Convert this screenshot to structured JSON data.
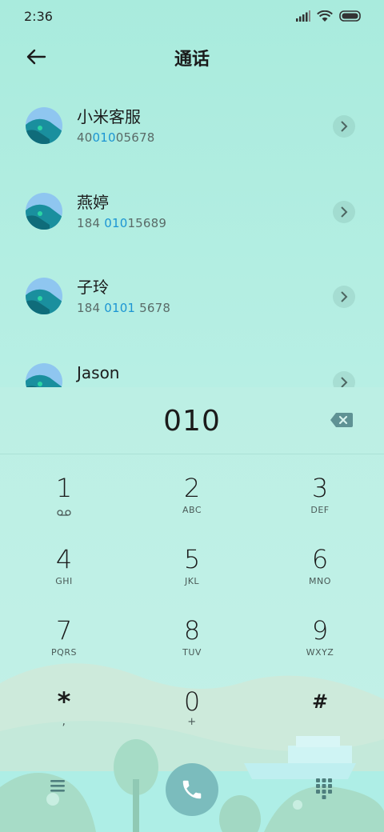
{
  "status_bar": {
    "time": "2:36"
  },
  "header": {
    "title": "通话"
  },
  "contacts": [
    {
      "name": "小米客服",
      "num_pre": "40",
      "num_hl": "010",
      "num_post": "05678"
    },
    {
      "name": "燕婷",
      "num_pre": "184 ",
      "num_hl": "010",
      "num_post": "15689"
    },
    {
      "name": "子玲",
      "num_pre": "184 ",
      "num_hl": "0101",
      "num_post": " 5678"
    },
    {
      "name": "Jason",
      "num_pre": "",
      "num_hl": "",
      "num_post": ""
    }
  ],
  "dialer": {
    "input": "010",
    "keys": [
      {
        "digit": "1",
        "letters": ""
      },
      {
        "digit": "2",
        "letters": "ABC"
      },
      {
        "digit": "3",
        "letters": "DEF"
      },
      {
        "digit": "4",
        "letters": "GHI"
      },
      {
        "digit": "5",
        "letters": "JKL"
      },
      {
        "digit": "6",
        "letters": "MNO"
      },
      {
        "digit": "7",
        "letters": "PQRS"
      },
      {
        "digit": "8",
        "letters": "TUV"
      },
      {
        "digit": "9",
        "letters": "WXYZ"
      },
      {
        "digit": "*",
        "letters": ","
      },
      {
        "digit": "0",
        "letters": "+"
      },
      {
        "digit": "#",
        "letters": ""
      }
    ]
  },
  "icons": {
    "back": "arrow-left-icon",
    "signal": "signal-icon",
    "wifi": "wifi-icon",
    "battery": "battery-icon",
    "chevron": "chevron-right-icon",
    "backspace": "backspace-icon",
    "voicemail": "voicemail-icon",
    "menu": "menu-icon",
    "call": "phone-icon",
    "keypad": "keypad-icon"
  },
  "colors": {
    "highlight": "#1c95d3",
    "call_button": "#7bbcbd"
  }
}
